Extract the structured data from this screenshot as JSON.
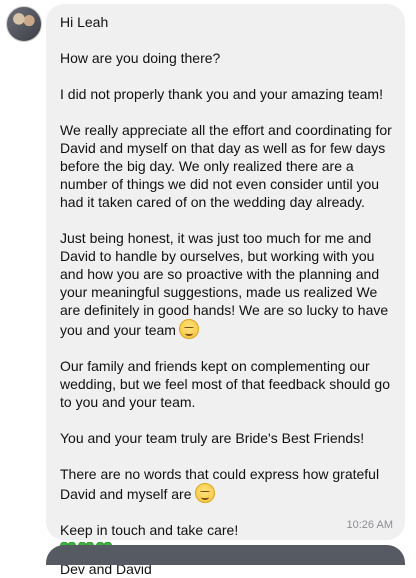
{
  "message": {
    "greeting": "Hi Leah",
    "p1": "How are you doing there?",
    "p2": "I did not properly thank you and your amazing team!",
    "p3": "We really appreciate all the effort and coordinating for David and myself on that day as well as for few days before the big day. We only realized there are a number of things we did not even consider until you had it taken cared of on the wedding day already.",
    "p4": "Just being honest, it was just too much for me and David to handle by ourselves, but working with you and how you are so proactive with the planning and your meaningful suggestions, made us realized We are definitely in good hands! We are so lucky to have you and your team",
    "p5": "Our family and friends kept on complementing our wedding, but we feel most of that feedback should go to you and your team.",
    "p6": "You and your team truly are Bride's Best Friends!",
    "p7": "There are no words that could express how grateful David and myself are",
    "p8": "Keep in touch and take care!",
    "signature": "Dev and David",
    "time": "10:26 AM"
  },
  "icons": {
    "emoji": "smiling-face-icon",
    "heart": "green-heart-icon",
    "heart_color": "#3cb33c"
  },
  "colors": {
    "bubble": "#f1f0f0",
    "text": "#111111",
    "timestamp": "#8a8d91"
  }
}
